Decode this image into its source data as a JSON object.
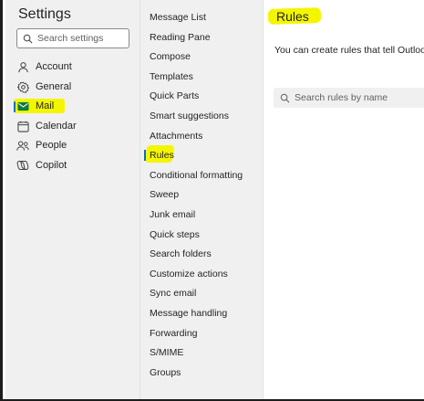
{
  "settings": {
    "title": "Settings",
    "search_placeholder": "Search settings"
  },
  "categories": [
    {
      "label": "Account",
      "icon": "person-icon"
    },
    {
      "label": "General",
      "icon": "gear-icon"
    },
    {
      "label": "Mail",
      "icon": "mail-icon",
      "selected": true
    },
    {
      "label": "Calendar",
      "icon": "calendar-icon"
    },
    {
      "label": "People",
      "icon": "people-icon"
    },
    {
      "label": "Copilot",
      "icon": "copilot-icon"
    }
  ],
  "mail_sections": [
    {
      "label": "Message List"
    },
    {
      "label": "Reading Pane"
    },
    {
      "label": "Compose"
    },
    {
      "label": "Templates"
    },
    {
      "label": "Quick Parts"
    },
    {
      "label": "Smart suggestions"
    },
    {
      "label": "Attachments"
    },
    {
      "label": "Rules",
      "selected": true
    },
    {
      "label": "Conditional formatting"
    },
    {
      "label": "Sweep"
    },
    {
      "label": "Junk email"
    },
    {
      "label": "Quick steps"
    },
    {
      "label": "Search folders"
    },
    {
      "label": "Customize actions"
    },
    {
      "label": "Sync email"
    },
    {
      "label": "Message handling"
    },
    {
      "label": "Forwarding"
    },
    {
      "label": "S/MIME"
    },
    {
      "label": "Groups"
    }
  ],
  "rules_pane": {
    "title": "Rules",
    "description": "You can create rules that tell Outlook ho",
    "search_placeholder": "Search rules by name"
  },
  "colors": {
    "highlight": "#f4f600",
    "accent": "#0f6cbd",
    "mail_icon": "#0f7b3e"
  }
}
